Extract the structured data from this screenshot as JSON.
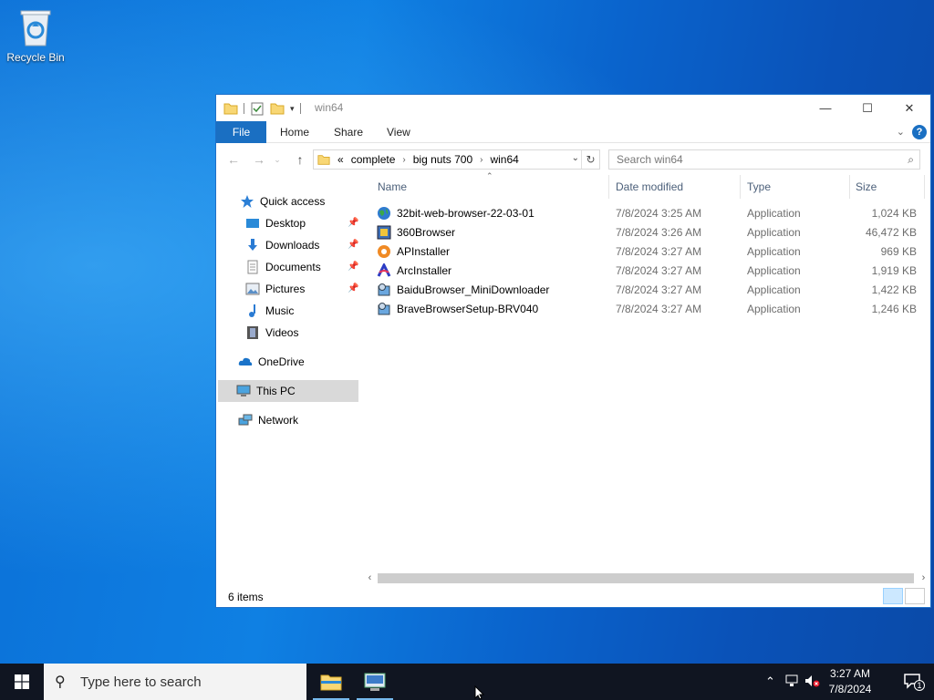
{
  "desktop": {
    "icons": [
      {
        "label": "Recycle Bin",
        "icon": "recycle-bin-icon"
      }
    ]
  },
  "window": {
    "title": "win64",
    "ribbon_tabs": [
      "File",
      "Home",
      "Share",
      "View"
    ],
    "address": {
      "overflow": "«",
      "segments": [
        "complete",
        "big nuts 700",
        "win64"
      ]
    },
    "search_placeholder": "Search win64",
    "nav": {
      "quick_access": "Quick access",
      "pinned": [
        "Desktop",
        "Downloads",
        "Documents",
        "Pictures"
      ],
      "unpinned": [
        "Music",
        "Videos"
      ],
      "onedrive": "OneDrive",
      "this_pc": "This PC",
      "network": "Network"
    },
    "columns": {
      "name": "Name",
      "date": "Date modified",
      "type": "Type",
      "size": "Size"
    },
    "files": [
      {
        "name": "32bit-web-browser-22-03-01",
        "date": "7/8/2024 3:25 AM",
        "type": "Application",
        "size": "1,024 KB",
        "icon": "globe-icon"
      },
      {
        "name": "360Browser",
        "date": "7/8/2024 3:26 AM",
        "type": "Application",
        "size": "46,472 KB",
        "icon": "installer-icon"
      },
      {
        "name": "APInstaller",
        "date": "7/8/2024 3:27 AM",
        "type": "Application",
        "size": "969 KB",
        "icon": "orange-app-icon"
      },
      {
        "name": "ArcInstaller",
        "date": "7/8/2024 3:27 AM",
        "type": "Application",
        "size": "1,919 KB",
        "icon": "arc-icon"
      },
      {
        "name": "BaiduBrowser_MiniDownloader",
        "date": "7/8/2024 3:27 AM",
        "type": "Application",
        "size": "1,422 KB",
        "icon": "setup-icon"
      },
      {
        "name": "BraveBrowserSetup-BRV040",
        "date": "7/8/2024 3:27 AM",
        "type": "Application",
        "size": "1,246 KB",
        "icon": "setup-icon"
      }
    ],
    "status": "6 items"
  },
  "taskbar": {
    "search_placeholder": "Type here to search",
    "time": "3:27 AM",
    "date": "7/8/2024",
    "notification_count": "1"
  }
}
